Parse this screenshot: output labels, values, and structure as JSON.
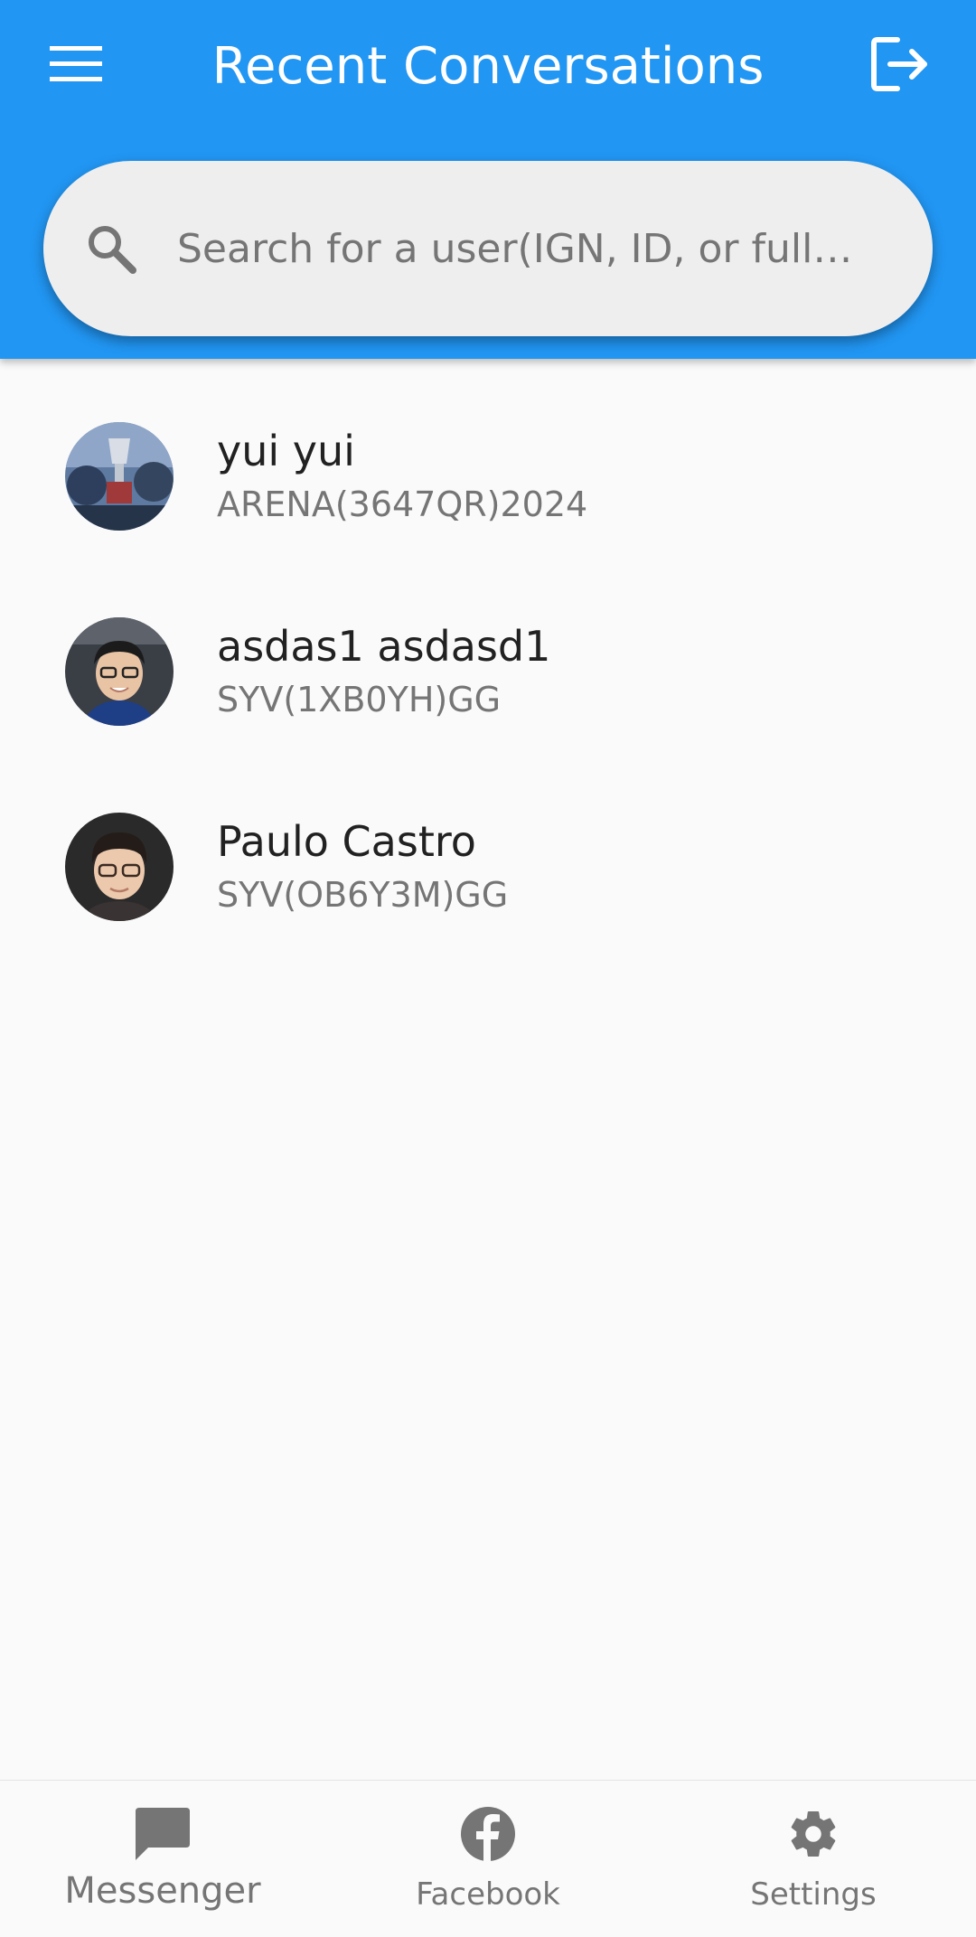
{
  "app_bar": {
    "title": "Recent Conversations",
    "menu_icon": "hamburger-menu-icon",
    "logout_icon": "logout-icon",
    "background_color": "#2196f3"
  },
  "search": {
    "placeholder": "Search for a user(IGN, ID, or full…",
    "value": "",
    "icon": "search-icon"
  },
  "conversations": [
    {
      "name": "yui yui",
      "subtitle": "ARENA(3647QR)2024"
    },
    {
      "name": "asdas1 asdasd1",
      "subtitle": "SYV(1XB0YH)GG"
    },
    {
      "name": "Paulo Castro",
      "subtitle": "SYV(OB6Y3M)GG"
    }
  ],
  "bottom_nav": {
    "items": [
      {
        "label": "Messenger",
        "icon": "chat-bubble-icon",
        "active": true
      },
      {
        "label": "Facebook",
        "icon": "facebook-icon",
        "active": false
      },
      {
        "label": "Settings",
        "icon": "gear-icon",
        "active": false
      }
    ],
    "icon_color": "#757575"
  }
}
